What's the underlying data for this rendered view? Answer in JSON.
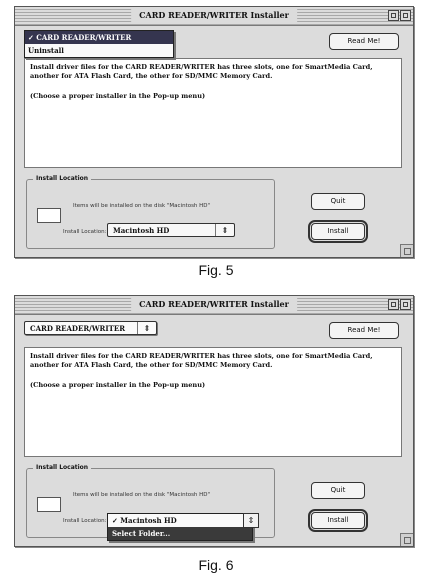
{
  "window_title": "CARD READER/WRITER Installer",
  "installer_popup": {
    "value": "CARD READER/WRITER",
    "arrow": "⇕"
  },
  "installer_menu": {
    "items": [
      {
        "label": "✓ CARD READER/WRITER",
        "selected": true
      },
      {
        "label": "Uninstall",
        "selected": false
      }
    ]
  },
  "readme_button": "Read Me!",
  "description": {
    "text": "Install driver files for the CARD READER/WRITER has three slots, one for SmartMedia Card, another for ATA Flash Card, the other for SD/MMC Memory Card.",
    "instruction": "(Choose a proper installer in the Pop-up menu)"
  },
  "install_location": {
    "label": "Install Location",
    "note": "Items will be installed on the disk \"Macintosh HD\"",
    "location_label": "Install Location:",
    "disk_value": "Macintosh HD",
    "arrow": "⇕"
  },
  "disk_menu": {
    "items": [
      {
        "label": "✓ Macintosh HD",
        "selected": false
      },
      {
        "label": "Select Folder...",
        "selected": true
      }
    ]
  },
  "quit_button": "Quit",
  "install_button": "Install",
  "figures": {
    "fig5": "Fig. 5",
    "fig6": "Fig. 6"
  }
}
